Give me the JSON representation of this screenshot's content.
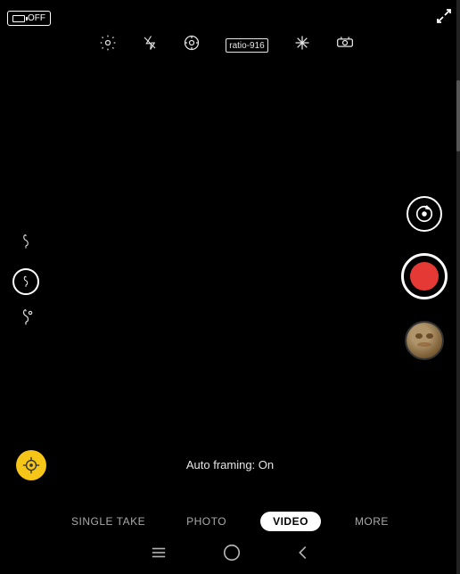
{
  "topBar": {
    "batteryLabel": "OFF",
    "expandIcon": "⤢"
  },
  "settingsRow": {
    "icons": [
      "gear",
      "flash-off",
      "motion",
      "ratio-916",
      "sparkle",
      "rotate"
    ]
  },
  "leftControls": {
    "icons": [
      "droplet-outline",
      "droplet-selected",
      "droplets-sparkle"
    ]
  },
  "rightControls": {
    "framingIcon": "rotate-circle",
    "recordLabel": "record",
    "thumbnailAlt": "last photo"
  },
  "autoFraming": {
    "text": "Auto framing: On",
    "emoji": "🎯"
  },
  "modeTabs": {
    "tabs": [
      "SINGLE TAKE",
      "PHOTO",
      "VIDEO",
      "MORE"
    ],
    "active": "VIDEO"
  },
  "systemNav": {
    "icons": [
      "recent-apps",
      "home",
      "back"
    ]
  }
}
